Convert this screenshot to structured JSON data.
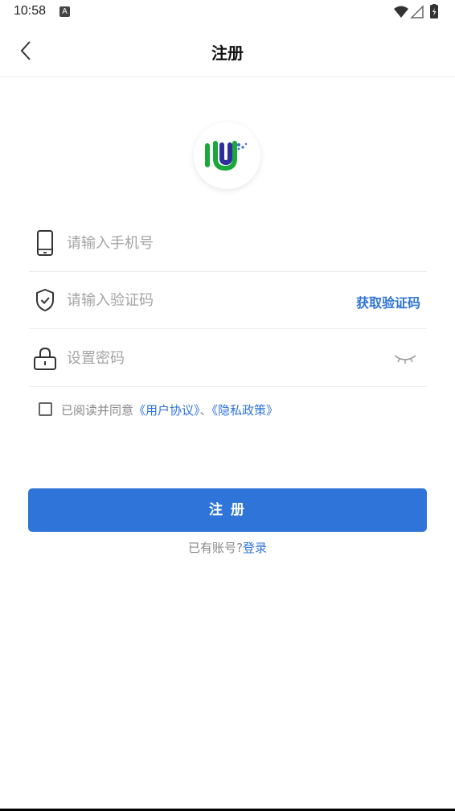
{
  "status": {
    "time": "10:58",
    "notification_badge": "A",
    "icons": [
      "wifi-icon",
      "signal-icon",
      "battery-icon"
    ]
  },
  "nav": {
    "title": "注册",
    "back_icon": "chevron-left-icon"
  },
  "logo": {
    "icon": "app-logo",
    "colors": {
      "green": "#1aa83a",
      "blue": "#2c2f9c",
      "accent": "#3a66d6"
    }
  },
  "form": {
    "phone": {
      "placeholder": "请输入手机号",
      "value": "",
      "icon": "phone-icon"
    },
    "code": {
      "placeholder": "请输入验证码",
      "value": "",
      "icon": "shield-check-icon",
      "get_code_label": "获取验证码"
    },
    "password": {
      "placeholder": "设置密码",
      "value": "",
      "icon": "lock-icon",
      "toggle_icon": "eye-closed-icon"
    }
  },
  "agreement": {
    "checked": false,
    "prefix": "已阅读并同意",
    "user_agreement": "《用户协议》",
    "separator": "、",
    "privacy_policy": "《隐私政策》"
  },
  "submit": {
    "label": "注 册"
  },
  "login": {
    "prompt": "已有账号?",
    "link": "登录"
  },
  "colors": {
    "primary": "#2f74d8",
    "placeholder": "#a4a4a4",
    "muted_text": "#888888",
    "divider": "#ececec"
  }
}
